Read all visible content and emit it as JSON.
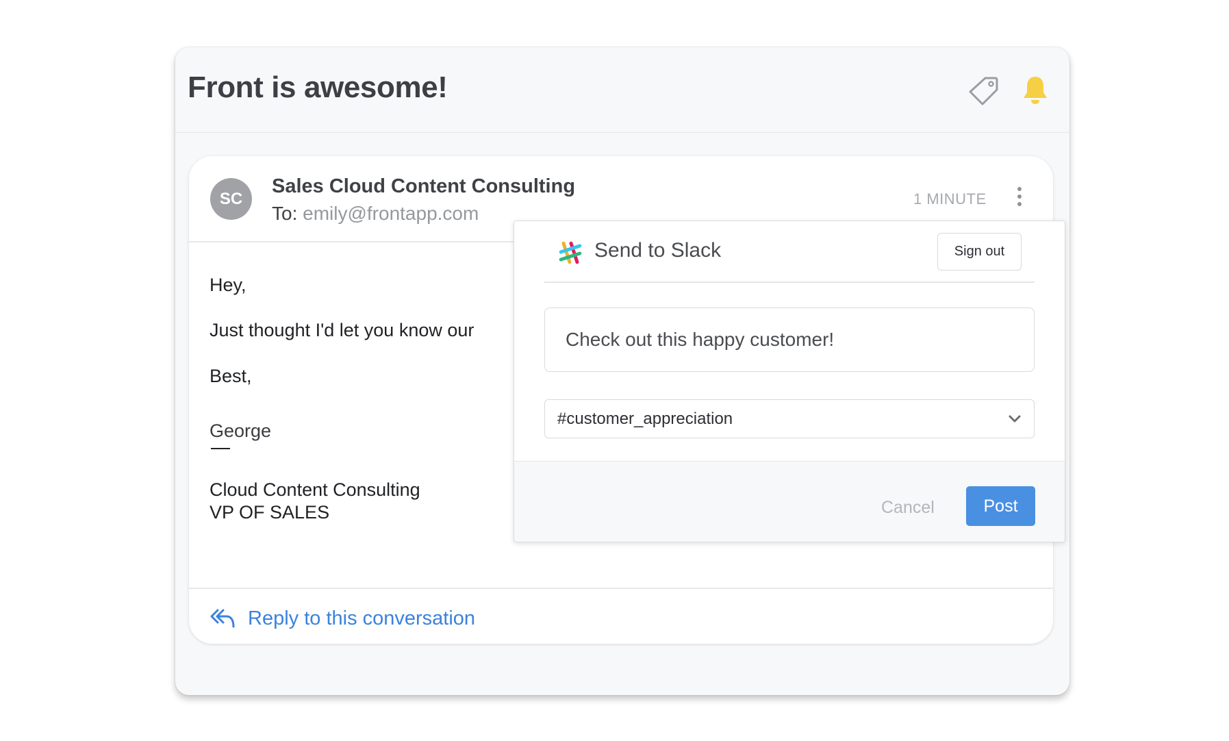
{
  "conversation": {
    "title": "Front is awesome!",
    "icons": {
      "tag": "tag-icon",
      "notification": "bell-icon"
    }
  },
  "message": {
    "avatar_initials": "SC",
    "sender_name": "Sales Cloud Content Consulting",
    "to_label": "To: ",
    "to_email": "emily@frontapp.com",
    "timestamp": "1 MINUTE",
    "body": {
      "greeting": "Hey,",
      "line1": "Just thought I'd let you know our",
      "closing": "Best,",
      "signature_name": "George",
      "company": "Cloud Content Consulting",
      "role": "VP OF SALES"
    },
    "reply_label": "Reply to this conversation"
  },
  "slack_popup": {
    "title": "Send to Slack",
    "sign_out_label": "Sign out",
    "message_value": "Check out this happy customer!",
    "channel_selected": "#customer_appreciation",
    "cancel_label": "Cancel",
    "post_label": "Post"
  },
  "colors": {
    "accent_blue": "#4a90e2",
    "link_blue": "#3b82dd",
    "bell_yellow": "#f7cf45",
    "avatar_gray": "#a1a2a6"
  }
}
